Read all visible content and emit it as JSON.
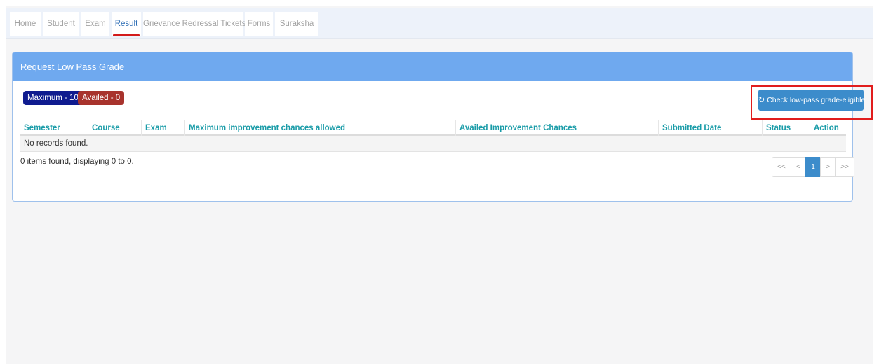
{
  "nav": {
    "tabs": [
      {
        "label": "Home"
      },
      {
        "label": "Student"
      },
      {
        "label": "Exam"
      },
      {
        "label": "Result"
      },
      {
        "label": "Grievance Redressal Tickets"
      },
      {
        "label": "Forms"
      },
      {
        "label": "Suraksha"
      }
    ],
    "active_tab": "Result"
  },
  "panel": {
    "title": "Request Low Pass Grade",
    "badges": {
      "maximum": "Maximum - 10",
      "availed": "Availed - 0"
    },
    "check_button": {
      "label": "Check low-pass grade-eligible",
      "icon": "refresh-icon"
    },
    "table": {
      "columns": [
        "Semester",
        "Course",
        "Exam",
        "Maximum improvement chances allowed",
        "Availed Improvement Chances",
        "Submitted Date",
        "Status",
        "Action"
      ],
      "empty_message": "No records found."
    },
    "summary": "0 items found, displaying 0 to 0.",
    "pager": {
      "first": "<<",
      "prev": "<",
      "current": "1",
      "next": ">",
      "last": ">>"
    }
  },
  "colors": {
    "panel_header": "#6fa9ef",
    "button": "#3c8ccb",
    "badge_max": "#0f1b8f",
    "badge_availed": "#a8332d",
    "column_header_text": "#1a9ca8",
    "active_tab_underline": "#d31b1b",
    "highlight_box": "#e11d1d"
  }
}
